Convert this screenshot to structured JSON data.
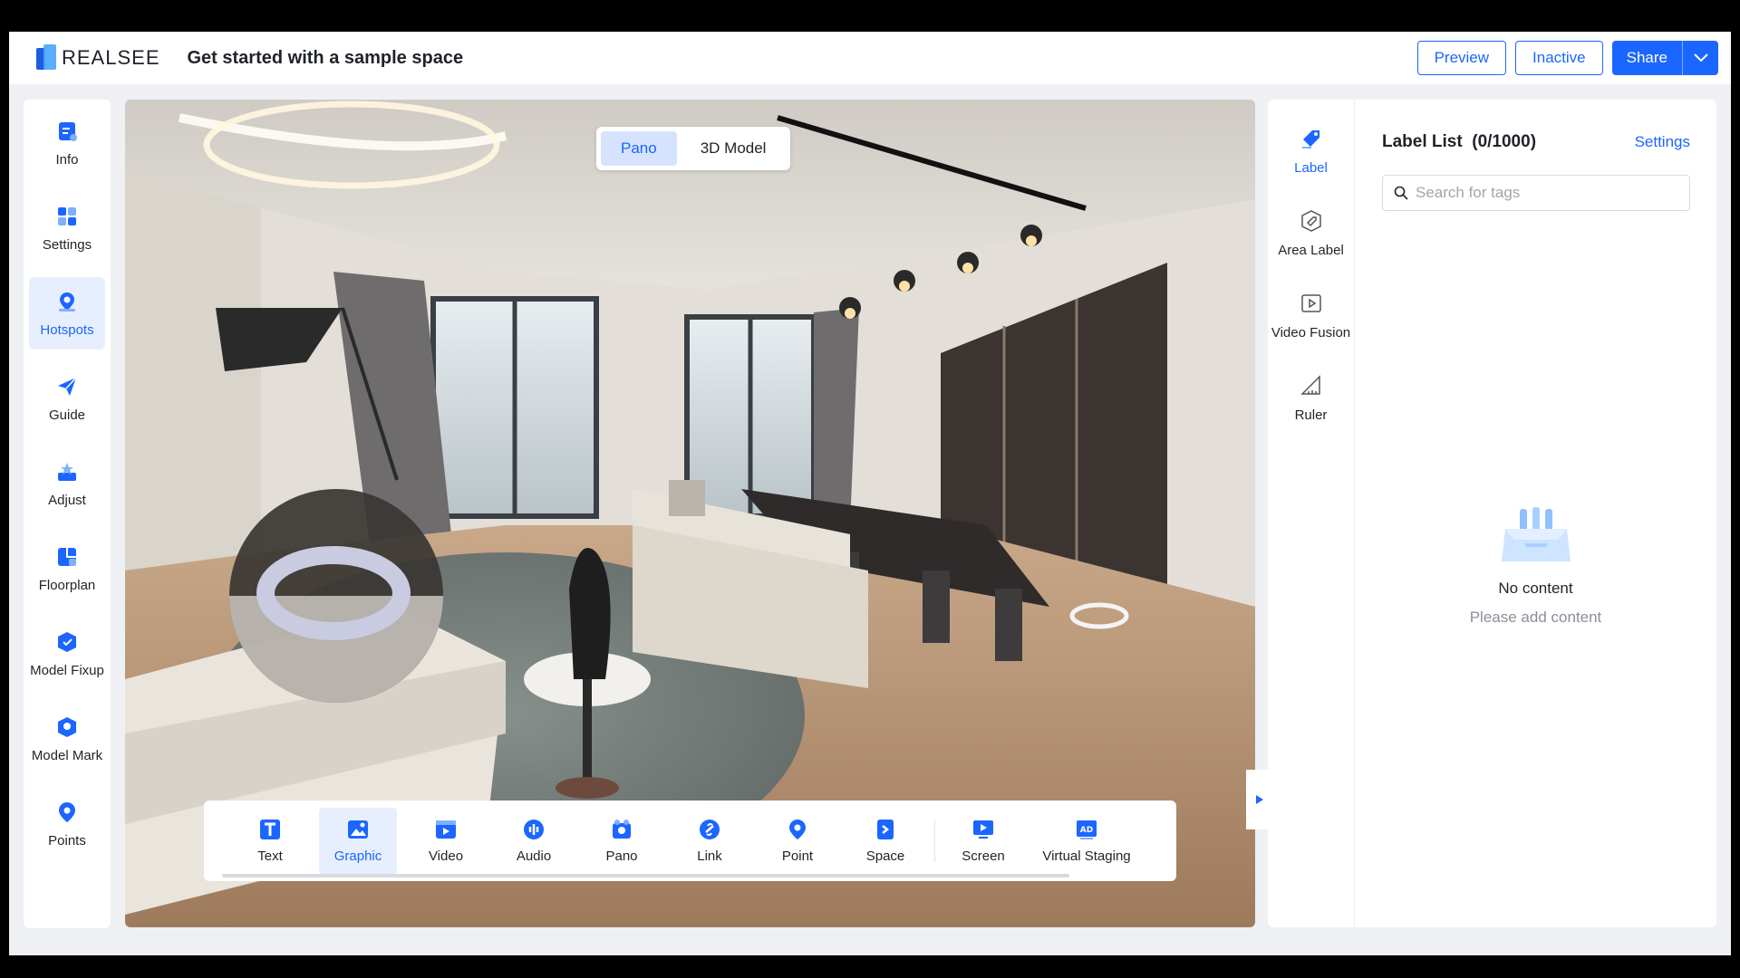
{
  "header": {
    "brand": "REALSEE",
    "title": "Get started with a sample space",
    "preview_label": "Preview",
    "inactive_label": "Inactive",
    "share_label": "Share"
  },
  "leftnav": {
    "items": [
      {
        "label": "Info",
        "icon": "info-icon"
      },
      {
        "label": "Settings",
        "icon": "settings-icon"
      },
      {
        "label": "Hotspots",
        "icon": "hotspots-icon",
        "active": true
      },
      {
        "label": "Guide",
        "icon": "guide-icon"
      },
      {
        "label": "Adjust",
        "icon": "adjust-icon"
      },
      {
        "label": "Floorplan",
        "icon": "floorplan-icon"
      },
      {
        "label": "Model Fixup",
        "icon": "model-fixup-icon"
      },
      {
        "label": "Model Mark",
        "icon": "model-mark-icon"
      },
      {
        "label": "Points",
        "icon": "points-icon"
      }
    ]
  },
  "viewer": {
    "toggle": {
      "pano": "Pano",
      "model": "3D Model",
      "active": "Pano"
    },
    "hotspots": [
      {
        "label": "Text",
        "icon": "text-icon"
      },
      {
        "label": "Graphic",
        "icon": "graphic-icon",
        "active": true
      },
      {
        "label": "Video",
        "icon": "video-icon"
      },
      {
        "label": "Audio",
        "icon": "audio-icon"
      },
      {
        "label": "Pano",
        "icon": "pano-icon"
      },
      {
        "label": "Link",
        "icon": "link-icon"
      },
      {
        "label": "Point",
        "icon": "point-icon"
      },
      {
        "label": "Space",
        "icon": "space-icon"
      },
      {
        "label": "Screen",
        "icon": "screen-icon"
      },
      {
        "label": "Virtual Staging",
        "icon": "virtual-staging-icon"
      }
    ]
  },
  "rightpanel": {
    "tabs": [
      {
        "label": "Label",
        "icon": "label-icon",
        "active": true
      },
      {
        "label": "Area Label",
        "icon": "area-label-icon"
      },
      {
        "label": "Video Fusion",
        "icon": "video-fusion-icon"
      },
      {
        "label": "Ruler",
        "icon": "ruler-icon"
      }
    ],
    "title": "Label List",
    "count": "(0/1000)",
    "settings_label": "Settings",
    "search_placeholder": "Search for tags",
    "empty_title": "No content",
    "empty_sub": "Please add content"
  },
  "colors": {
    "accent": "#1b66ff",
    "active_bg": "#e7efff"
  }
}
